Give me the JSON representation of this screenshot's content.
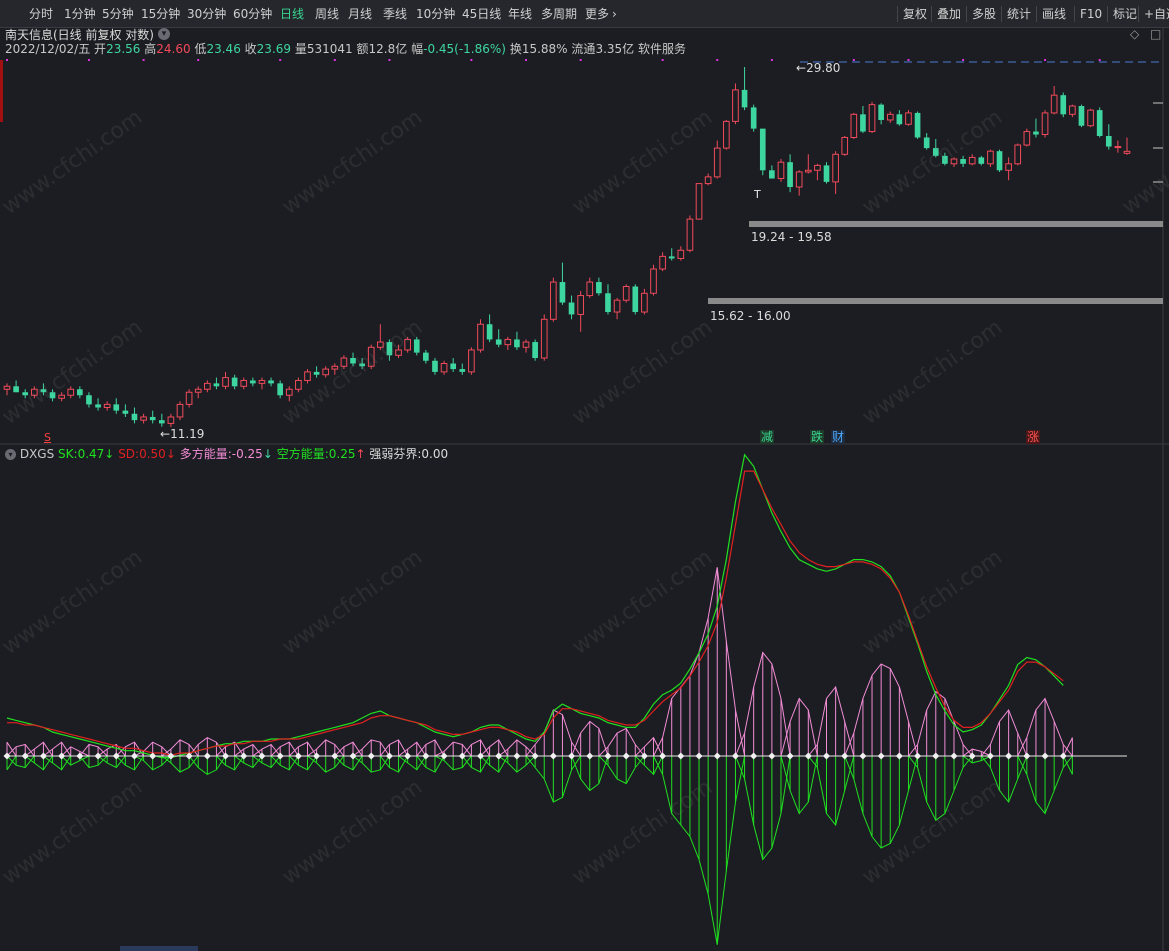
{
  "toolbar": {
    "left": [
      {
        "label": "分时"
      },
      {
        "label": "1分钟"
      },
      {
        "label": "5分钟"
      },
      {
        "label": "15分钟"
      },
      {
        "label": "30分钟"
      },
      {
        "label": "60分钟"
      },
      {
        "label": "日线",
        "active": true
      },
      {
        "label": "周线"
      },
      {
        "label": "月线"
      },
      {
        "label": "季线"
      },
      {
        "label": "10分钟"
      },
      {
        "label": "45日线"
      },
      {
        "label": "年线"
      },
      {
        "label": "多周期"
      },
      {
        "label": "更多"
      }
    ],
    "more_chevron": "›",
    "right": [
      {
        "label": "复权"
      },
      {
        "label": "叠加"
      },
      {
        "label": "多股"
      },
      {
        "label": "统计"
      },
      {
        "label": "画线"
      },
      {
        "label": "F10"
      },
      {
        "label": "标记"
      },
      {
        "label": "+自选"
      }
    ]
  },
  "stock": {
    "title": "南天信息(日线 前复权 对数)",
    "date": "2022/12/02/五",
    "open_label": "开",
    "open": "23.56",
    "high_label": "高",
    "high": "24.60",
    "low_label": "低",
    "low": "23.46",
    "close_label": "收",
    "close": "23.69",
    "vol_label": "量",
    "vol": "531041",
    "amt_label": "额",
    "amt": "12.8亿",
    "chg_label": "幅",
    "chg": "-0.45(-1.86%)",
    "turn_label": "换",
    "turn": "15.88%",
    "float_label": "流通",
    "float": "3.35亿",
    "sector": "软件服务"
  },
  "annotations": {
    "high_price": "29.80",
    "low_price": "11.19",
    "zone_upper": "19.24 - 19.58",
    "zone_lower": "15.62 - 16.00",
    "t_marker": "T",
    "s_marker": "S"
  },
  "events": [
    {
      "label": "减",
      "color": "#38d68e"
    },
    {
      "label": "跌",
      "color": "#38d68e"
    },
    {
      "label": "财",
      "color": "#4aa8ff"
    },
    {
      "label": "涨",
      "color": "#ff5050"
    }
  ],
  "indicator": {
    "name": "DXGS",
    "sk_label": "SK:",
    "sk": "0.47",
    "sk_arrow": "↓",
    "sd_label": "SD:",
    "sd": "0.50",
    "sd_arrow": "↓",
    "duo_label": "多方能量:",
    "duo": "-0.25",
    "duo_arrow": "↓",
    "kong_label": "空方能量:",
    "kong": "0.25",
    "kong_arrow": "↑",
    "qr_label": "强弱芬界:",
    "qr": "0.00"
  },
  "colors": {
    "up": "#f04a5a",
    "down": "#3ed6a0",
    "green_line": "#20e020",
    "red_line": "#e02020",
    "pink": "#f28cd6",
    "zone": "#8a8a8a"
  },
  "chart_data": {
    "type": "candlestick",
    "price_scale": "log",
    "candles": [
      [
        12.4,
        12.6,
        12.2,
        12.5
      ],
      [
        12.5,
        12.7,
        12.3,
        12.3
      ],
      [
        12.3,
        12.4,
        12.1,
        12.2
      ],
      [
        12.2,
        12.5,
        12.1,
        12.4
      ],
      [
        12.4,
        12.6,
        12.2,
        12.3
      ],
      [
        12.3,
        12.4,
        12.0,
        12.1
      ],
      [
        12.1,
        12.3,
        12.0,
        12.2
      ],
      [
        12.2,
        12.5,
        12.1,
        12.4
      ],
      [
        12.4,
        12.5,
        12.1,
        12.2
      ],
      [
        12.2,
        12.3,
        11.8,
        11.9
      ],
      [
        11.9,
        12.1,
        11.7,
        11.8
      ],
      [
        11.8,
        12.0,
        11.7,
        11.9
      ],
      [
        11.9,
        12.1,
        11.6,
        11.7
      ],
      [
        11.7,
        11.9,
        11.5,
        11.6
      ],
      [
        11.6,
        11.8,
        11.3,
        11.4
      ],
      [
        11.4,
        11.6,
        11.3,
        11.5
      ],
      [
        11.5,
        11.7,
        11.3,
        11.4
      ],
      [
        11.4,
        11.6,
        11.2,
        11.3
      ],
      [
        11.3,
        11.6,
        11.19,
        11.5
      ],
      [
        11.5,
        12.0,
        11.4,
        11.9
      ],
      [
        11.9,
        12.4,
        11.8,
        12.3
      ],
      [
        12.3,
        12.5,
        12.1,
        12.4
      ],
      [
        12.4,
        12.7,
        12.3,
        12.6
      ],
      [
        12.6,
        12.8,
        12.4,
        12.5
      ],
      [
        12.5,
        13.0,
        12.4,
        12.8
      ],
      [
        12.8,
        12.9,
        12.4,
        12.5
      ],
      [
        12.5,
        12.8,
        12.4,
        12.7
      ],
      [
        12.7,
        12.8,
        12.5,
        12.6
      ],
      [
        12.6,
        12.8,
        12.4,
        12.7
      ],
      [
        12.7,
        12.8,
        12.5,
        12.6
      ],
      [
        12.6,
        12.7,
        12.1,
        12.2
      ],
      [
        12.2,
        12.5,
        12.0,
        12.4
      ],
      [
        12.4,
        12.8,
        12.3,
        12.7
      ],
      [
        12.7,
        13.1,
        12.6,
        13.0
      ],
      [
        13.0,
        13.2,
        12.8,
        12.9
      ],
      [
        12.9,
        13.2,
        12.8,
        13.1
      ],
      [
        13.1,
        13.3,
        12.9,
        13.2
      ],
      [
        13.2,
        13.6,
        13.1,
        13.5
      ],
      [
        13.5,
        13.7,
        13.2,
        13.3
      ],
      [
        13.3,
        13.5,
        13.1,
        13.2
      ],
      [
        13.2,
        14.0,
        13.1,
        13.9
      ],
      [
        13.9,
        14.8,
        13.8,
        14.1
      ],
      [
        14.1,
        14.2,
        13.4,
        13.6
      ],
      [
        13.6,
        14.0,
        13.5,
        13.8
      ],
      [
        13.8,
        14.3,
        13.7,
        14.2
      ],
      [
        14.2,
        14.3,
        13.6,
        13.7
      ],
      [
        13.7,
        13.8,
        13.3,
        13.4
      ],
      [
        13.4,
        13.5,
        12.9,
        13.0
      ],
      [
        13.0,
        13.4,
        12.9,
        13.3
      ],
      [
        13.3,
        13.5,
        13.0,
        13.1
      ],
      [
        13.1,
        13.3,
        12.9,
        13.0
      ],
      [
        13.0,
        13.9,
        12.9,
        13.8
      ],
      [
        13.8,
        15.0,
        13.7,
        14.8
      ],
      [
        14.8,
        15.2,
        14.1,
        14.2
      ],
      [
        14.2,
        14.6,
        13.9,
        14.0
      ],
      [
        14.0,
        14.3,
        13.8,
        14.2
      ],
      [
        14.2,
        14.5,
        13.8,
        13.9
      ],
      [
        13.9,
        14.2,
        13.7,
        14.1
      ],
      [
        14.1,
        14.2,
        13.4,
        13.5
      ],
      [
        13.5,
        15.2,
        13.4,
        15.0
      ],
      [
        15.0,
        16.8,
        14.9,
        16.6
      ],
      [
        16.6,
        17.5,
        15.6,
        15.7
      ],
      [
        15.7,
        16.0,
        15.0,
        15.2
      ],
      [
        15.2,
        16.2,
        14.5,
        16.0
      ],
      [
        16.0,
        16.8,
        15.9,
        16.6
      ],
      [
        16.6,
        16.8,
        16.0,
        16.1
      ],
      [
        16.1,
        16.5,
        15.2,
        15.3
      ],
      [
        15.3,
        15.9,
        15.0,
        15.8
      ],
      [
        15.8,
        16.5,
        15.7,
        16.4
      ],
      [
        16.4,
        16.5,
        15.2,
        15.3
      ],
      [
        15.3,
        16.3,
        15.2,
        16.1
      ],
      [
        16.1,
        17.4,
        16.0,
        17.2
      ],
      [
        17.2,
        18.0,
        17.1,
        17.8
      ],
      [
        17.8,
        18.2,
        17.6,
        17.7
      ],
      [
        17.7,
        18.3,
        17.6,
        18.1
      ],
      [
        18.1,
        19.9,
        18.0,
        19.7
      ],
      [
        19.7,
        21.7,
        19.7,
        21.7
      ],
      [
        21.7,
        22.3,
        21.6,
        22.1
      ],
      [
        22.1,
        24.4,
        22.0,
        23.9
      ],
      [
        23.9,
        25.8,
        23.8,
        25.7
      ],
      [
        25.7,
        28.5,
        25.5,
        28.0
      ],
      [
        28.0,
        29.8,
        26.5,
        26.7
      ],
      [
        26.7,
        26.9,
        25.0,
        25.2
      ],
      [
        25.2,
        23.0,
        22.2,
        22.5
      ],
      [
        22.5,
        22.8,
        22.0,
        22.0
      ],
      [
        22.0,
        23.2,
        21.8,
        23.0
      ],
      [
        23.0,
        23.5,
        21.2,
        21.5
      ],
      [
        21.5,
        22.5,
        21.0,
        22.4
      ],
      [
        22.4,
        23.5,
        22.3,
        22.5
      ],
      [
        22.5,
        22.9,
        21.9,
        22.8
      ],
      [
        22.8,
        23.0,
        21.7,
        21.8
      ],
      [
        21.8,
        23.7,
        21.1,
        23.5
      ],
      [
        23.5,
        24.7,
        23.4,
        24.6
      ],
      [
        24.6,
        26.3,
        24.5,
        26.2
      ],
      [
        26.2,
        26.8,
        24.9,
        25.0
      ],
      [
        25.0,
        27.1,
        24.9,
        26.9
      ],
      [
        26.9,
        27.0,
        25.5,
        25.8
      ],
      [
        25.8,
        26.4,
        25.6,
        26.2
      ],
      [
        26.2,
        26.5,
        25.4,
        25.5
      ],
      [
        25.5,
        26.5,
        25.4,
        26.3
      ],
      [
        26.3,
        26.4,
        24.5,
        24.6
      ],
      [
        24.6,
        24.9,
        23.8,
        23.9
      ],
      [
        23.9,
        24.5,
        23.3,
        23.4
      ],
      [
        23.4,
        23.6,
        22.8,
        22.9
      ],
      [
        22.9,
        23.3,
        22.7,
        23.2
      ],
      [
        23.2,
        23.4,
        22.7,
        22.9
      ],
      [
        22.9,
        23.5,
        22.8,
        23.3
      ],
      [
        23.3,
        23.4,
        22.8,
        22.9
      ],
      [
        22.9,
        23.8,
        22.7,
        23.7
      ],
      [
        23.7,
        23.8,
        22.4,
        22.5
      ],
      [
        22.5,
        23.3,
        21.9,
        22.9
      ],
      [
        22.9,
        24.2,
        22.8,
        24.1
      ],
      [
        24.1,
        25.2,
        24.0,
        25.0
      ],
      [
        25.0,
        25.9,
        24.6,
        24.8
      ],
      [
        24.8,
        26.5,
        24.6,
        26.3
      ],
      [
        26.3,
        28.3,
        26.2,
        27.6
      ],
      [
        27.6,
        27.8,
        26.0,
        26.2
      ],
      [
        26.2,
        26.9,
        26.0,
        26.8
      ],
      [
        26.8,
        26.9,
        25.3,
        25.4
      ],
      [
        25.4,
        26.6,
        25.3,
        26.5
      ],
      [
        26.5,
        26.7,
        24.6,
        24.7
      ],
      [
        24.7,
        25.5,
        23.8,
        24.0
      ],
      [
        24.0,
        24.4,
        23.6,
        24.0
      ],
      [
        23.56,
        24.6,
        23.46,
        23.69
      ]
    ],
    "indicator_series": {
      "sk": [
        0.12,
        0.11,
        0.1,
        0.09,
        0.08,
        0.06,
        0.05,
        0.04,
        0.03,
        0.02,
        0.01,
        0.0,
        -0.01,
        -0.02,
        -0.02,
        -0.03,
        -0.04,
        -0.05,
        -0.05,
        -0.04,
        -0.03,
        -0.02,
        -0.01,
        0.0,
        0.01,
        0.01,
        0.02,
        0.02,
        0.02,
        0.03,
        0.03,
        0.03,
        0.04,
        0.05,
        0.06,
        0.07,
        0.08,
        0.09,
        0.1,
        0.12,
        0.14,
        0.15,
        0.13,
        0.12,
        0.11,
        0.1,
        0.08,
        0.06,
        0.05,
        0.04,
        0.05,
        0.06,
        0.08,
        0.09,
        0.09,
        0.07,
        0.05,
        0.03,
        0.02,
        0.06,
        0.15,
        0.18,
        0.16,
        0.14,
        0.13,
        0.12,
        0.1,
        0.09,
        0.08,
        0.08,
        0.12,
        0.18,
        0.22,
        0.24,
        0.27,
        0.33,
        0.4,
        0.48,
        0.6,
        0.8,
        1.05,
        1.25,
        1.2,
        1.1,
        1.0,
        0.92,
        0.85,
        0.8,
        0.78,
        0.76,
        0.75,
        0.76,
        0.78,
        0.8,
        0.8,
        0.79,
        0.77,
        0.73,
        0.66,
        0.55,
        0.44,
        0.32,
        0.22,
        0.15,
        0.09,
        0.06,
        0.07,
        0.09,
        0.14,
        0.2,
        0.26,
        0.35,
        0.38,
        0.37,
        0.34,
        0.3,
        0.26
      ],
      "sd": [
        0.1,
        0.1,
        0.09,
        0.09,
        0.08,
        0.07,
        0.06,
        0.05,
        0.04,
        0.03,
        0.02,
        0.01,
        0.0,
        -0.01,
        -0.01,
        -0.02,
        -0.03,
        -0.03,
        -0.04,
        -0.03,
        -0.03,
        -0.02,
        -0.01,
        0.0,
        0.0,
        0.01,
        0.01,
        0.02,
        0.02,
        0.02,
        0.03,
        0.03,
        0.03,
        0.04,
        0.05,
        0.06,
        0.07,
        0.08,
        0.09,
        0.1,
        0.12,
        0.13,
        0.13,
        0.12,
        0.11,
        0.1,
        0.09,
        0.07,
        0.06,
        0.05,
        0.05,
        0.06,
        0.07,
        0.08,
        0.08,
        0.07,
        0.06,
        0.04,
        0.03,
        0.05,
        0.12,
        0.16,
        0.16,
        0.15,
        0.14,
        0.13,
        0.11,
        0.1,
        0.09,
        0.09,
        0.11,
        0.15,
        0.19,
        0.22,
        0.25,
        0.3,
        0.36,
        0.43,
        0.53,
        0.72,
        0.95,
        1.18,
        1.18,
        1.1,
        1.02,
        0.95,
        0.88,
        0.83,
        0.8,
        0.78,
        0.77,
        0.77,
        0.78,
        0.79,
        0.79,
        0.78,
        0.76,
        0.72,
        0.66,
        0.56,
        0.45,
        0.34,
        0.25,
        0.17,
        0.11,
        0.08,
        0.08,
        0.1,
        0.14,
        0.19,
        0.24,
        0.32,
        0.36,
        0.36,
        0.34,
        0.31,
        0.28
      ],
      "energy": [
        0.06,
        -0.04,
        -0.05,
        0.03,
        0.06,
        -0.03,
        -0.06,
        0.04,
        0.02,
        -0.05,
        -0.04,
        0.03,
        0.05,
        -0.04,
        -0.06,
        0.02,
        0.06,
        0.04,
        -0.03,
        -0.07,
        -0.05,
        0.05,
        0.08,
        0.06,
        -0.04,
        -0.06,
        0.03,
        0.05,
        -0.03,
        -0.05,
        0.04,
        0.06,
        -0.04,
        -0.06,
        0.03,
        0.07,
        0.05,
        -0.04,
        -0.06,
        0.03,
        0.07,
        0.06,
        -0.05,
        -0.07,
        0.03,
        0.06,
        -0.05,
        -0.07,
        0.02,
        0.06,
        0.05,
        -0.05,
        -0.07,
        0.04,
        0.07,
        -0.03,
        -0.07,
        -0.04,
        0.05,
        0.1,
        0.2,
        0.18,
        0.06,
        -0.1,
        -0.15,
        -0.12,
        0.04,
        0.1,
        0.12,
        0.05,
        -0.04,
        -0.08,
        0.08,
        0.25,
        0.3,
        0.35,
        0.45,
        0.6,
        0.82,
        0.5,
        0.2,
        -0.1,
        -0.3,
        -0.45,
        -0.4,
        -0.25,
        0.15,
        0.25,
        0.2,
        -0.05,
        -0.25,
        -0.3,
        -0.15,
        0.1,
        0.25,
        0.35,
        0.4,
        0.38,
        0.3,
        0.15,
        -0.05,
        -0.2,
        -0.28,
        -0.25,
        -0.15,
        -0.05,
        0.03,
        0.02,
        -0.05,
        -0.15,
        -0.2,
        -0.1,
        0.08,
        0.2,
        0.25,
        0.15,
        0.05,
        -0.08
      ]
    }
  }
}
